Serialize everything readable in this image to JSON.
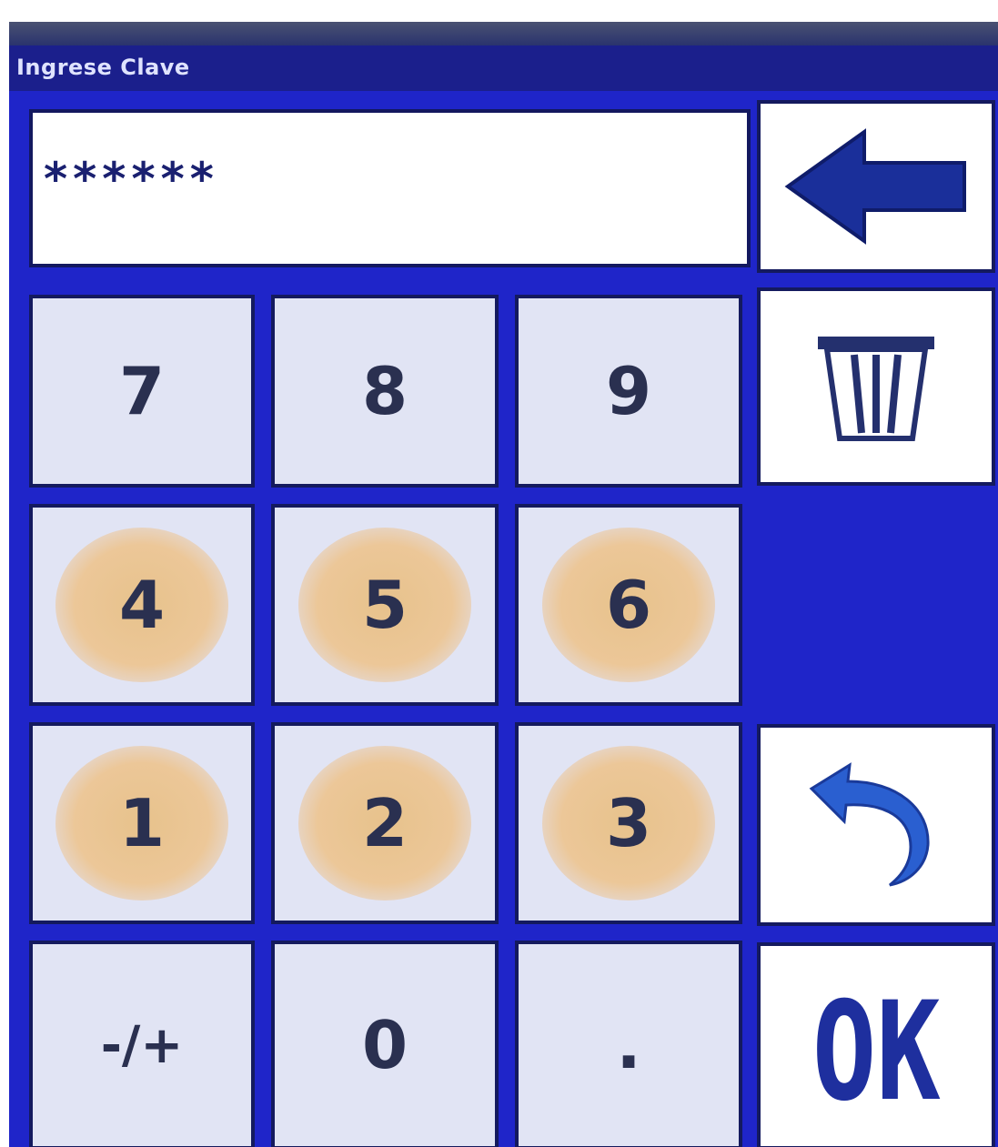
{
  "dialog": {
    "title": "Ingrese Clave"
  },
  "display": {
    "value": "******"
  },
  "keypad": {
    "rows": [
      [
        {
          "label": "7"
        },
        {
          "label": "8"
        },
        {
          "label": "9"
        }
      ],
      [
        {
          "label": "4"
        },
        {
          "label": "5"
        },
        {
          "label": "6"
        }
      ],
      [
        {
          "label": "1"
        },
        {
          "label": "2"
        },
        {
          "label": "3"
        }
      ],
      [
        {
          "label": "-/+"
        },
        {
          "label": "0"
        },
        {
          "label": "."
        }
      ]
    ]
  },
  "side_buttons": {
    "backspace_icon": "left-arrow-icon",
    "clear_icon": "trash-icon",
    "undo_icon": "undo-arrow-icon",
    "ok_label": "OK"
  },
  "colors": {
    "background": "#1f25c9",
    "key_face": "#e1e4f4",
    "key_touched": "#ecc798",
    "accent": "#1e2f9e"
  }
}
